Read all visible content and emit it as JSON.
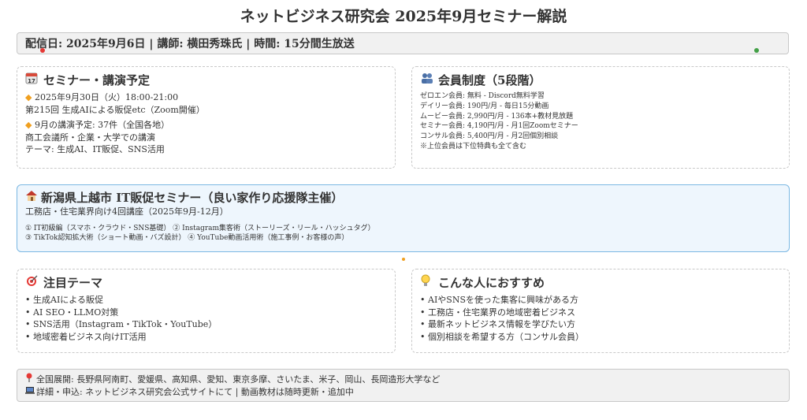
{
  "page": {
    "title": "ネットビジネス研究会 2025年9月セミナー解説",
    "info_bar": "配信日: 2025年9月6日 | 講師: 横田秀珠氏 | 時間: 15分間生放送"
  },
  "colors": {
    "accent": "#f0a020",
    "feature_border": "#7bb8e3",
    "feature_bg": "#eef6fd"
  },
  "seminar": {
    "icon": "calendar-icon",
    "title": "セミナー・講演予定",
    "item1_bullet": "◆",
    "item1_line1": "2025年9月30日（火）18:00-21:00",
    "item1_line2": "第215回 生成AIによる販促etc（Zoom開催）",
    "item2_bullet": "◆",
    "item2_line1": "9月の講演予定: 37件（全国各地）",
    "item2_line2": "商工会議所・企業・大学での講演",
    "item2_line3": "テーマ: 生成AI、IT販促、SNS活用"
  },
  "membership": {
    "icon": "people-icon",
    "title": "会員制度（5段階）",
    "tiers": [
      "ゼロエン会員: 無料 - Discord無料学習",
      "デイリー会員: 190円/月 - 毎日15分動画",
      "ムービー会員: 2,990円/月 - 136本+教材見放題",
      "セミナー会員: 4,190円/月 - 月1回Zoomセミナー",
      "コンサル会員: 5,400円/月 - 月2回個別相談",
      "※上位会員は下位特典も全て含む"
    ]
  },
  "feature": {
    "icon": "house-icon",
    "title": "新潟県上越市 IT販促セミナー（良い家作り応援隊主催）",
    "subtitle": "工務店・住宅業界向け4回講座（2025年9月-12月）",
    "line1": "① IT初級編（スマホ・クラウド・SNS基礎） ② Instagram集客術（ストーリーズ・リール・ハッシュタグ）",
    "line2": "③ TikTok認知拡大術（ショート動画・バズ設計） ④ YouTube動画活用術（施工事例・お客様の声）"
  },
  "themes": {
    "icon": "target-icon",
    "title": "注目テーマ",
    "items": [
      "生成AIによる販促",
      "AI SEO・LLMO対策",
      "SNS活用（Instagram・TikTok・YouTube）",
      "地域密着ビジネス向けIT活用"
    ]
  },
  "recommend": {
    "icon": "lightbulb-icon",
    "title": "こんな人におすすめ",
    "items": [
      "AIやSNSを使った集客に興味がある方",
      "工務店・住宅業界の地域密着ビジネス",
      "最新ネットビジネス情報を学びたい方",
      "個別相談を希望する方（コンサル会員）"
    ]
  },
  "footer": {
    "line1": "全国展開: 長野県阿南町、愛媛県、高知県、愛知、東京多摩、さいたま、米子、岡山、長岡造形大学など",
    "line2": "詳細・申込: ネットビジネス研究会公式サイトにて | 動画教材は随時更新・追加中"
  }
}
